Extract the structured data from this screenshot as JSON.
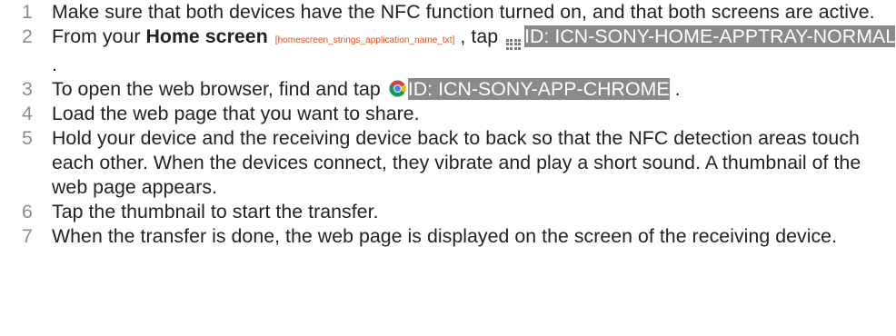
{
  "header_sliver": "",
  "steps": [
    {
      "num": "1",
      "text": "Make sure that both devices have the NFC function turned on, and that both screens are active."
    },
    {
      "num": "2",
      "text_a": "From your ",
      "bold": "Home screen",
      "tag": "[homescreen_strings_application_name_txt]",
      "text_b": " , tap ",
      "icon_name": "apptray-icon",
      "highlight": "ID: ICN-SONY-HOME-APPTRAY-NORMAL",
      "text_c": " ."
    },
    {
      "num": "3",
      "text_a": "To open the web browser, find and tap ",
      "icon_name": "chrome-icon",
      "highlight": "ID: ICN-SONY-APP-CHROME",
      "text_b": " ."
    },
    {
      "num": "4",
      "text": "Load the web page that you want to share."
    },
    {
      "num": "5",
      "text": "Hold your device and the receiving device back to back so that the NFC detection areas touch each other. When the devices connect, they vibrate and play a short sound. A thumbnail of the web page appears."
    },
    {
      "num": "6",
      "text": "Tap the thumbnail to start the transfer."
    },
    {
      "num": "7",
      "text": "When the transfer is done, the web page is displayed on the screen of the receiving device."
    }
  ],
  "colors": {
    "step_number": "#8c8c8c",
    "body_text": "#222222",
    "tag_text": "#d94f1e",
    "highlight_bg": "#8a8a8a",
    "highlight_text": "#ffffff"
  }
}
